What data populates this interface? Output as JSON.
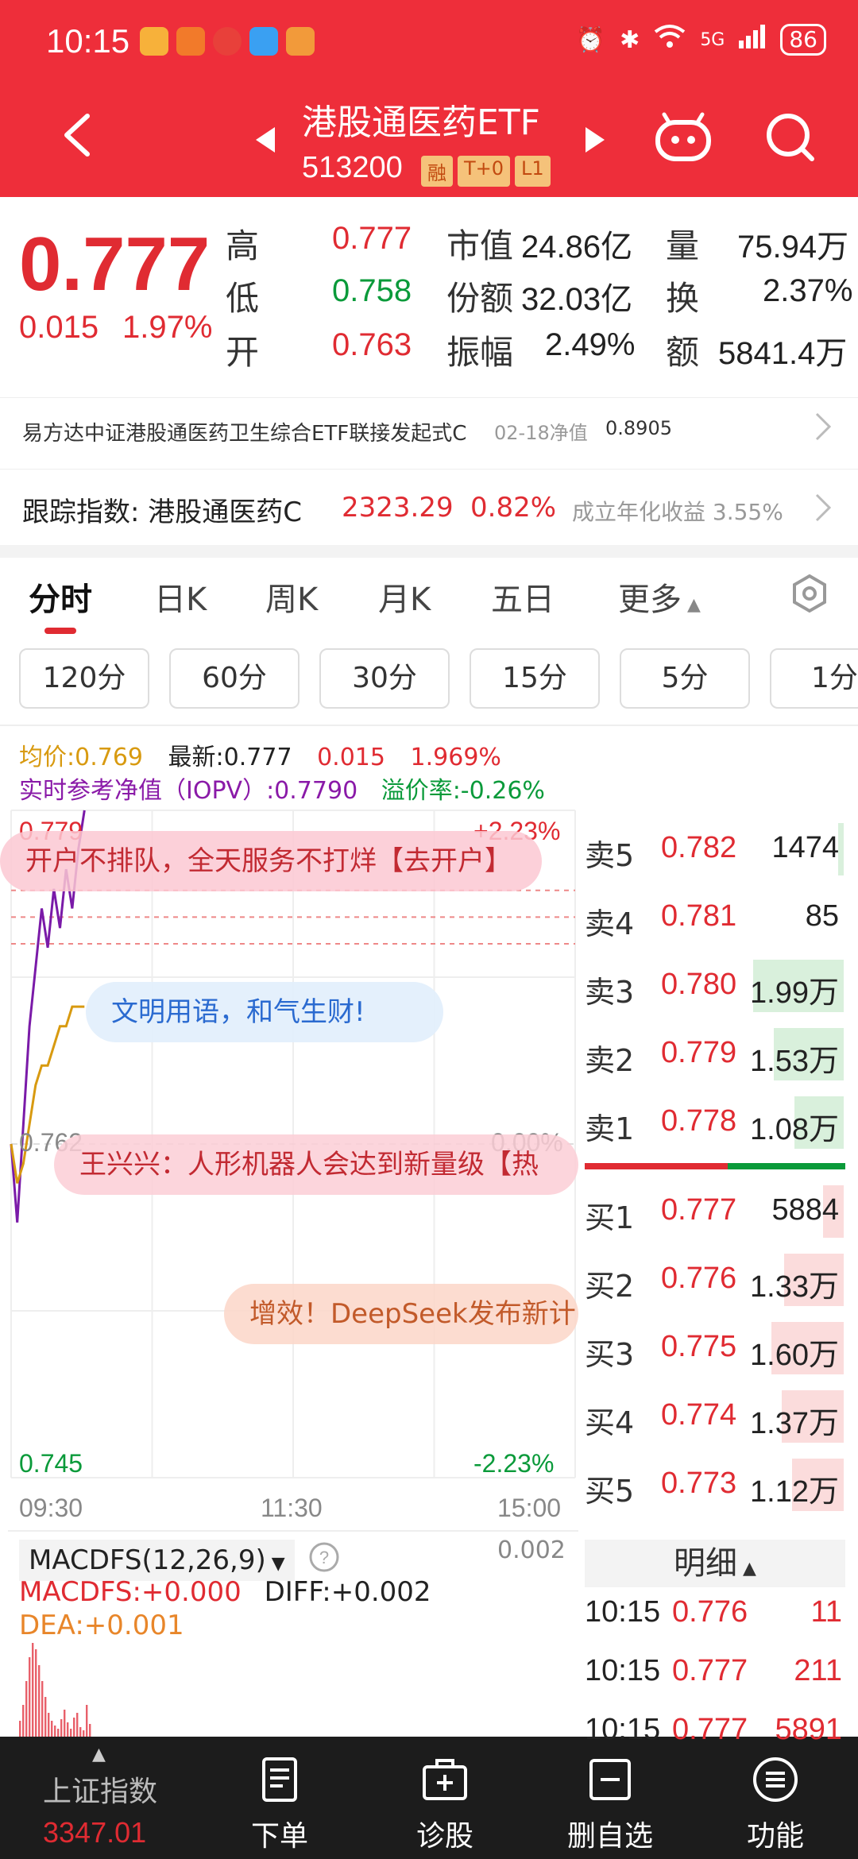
{
  "status_bar": {
    "time": "10:15",
    "battery": "86",
    "network": "5G"
  },
  "header": {
    "name": "港股通医药ETF",
    "code": "513200",
    "tags": [
      "融",
      "T+0",
      "L1"
    ]
  },
  "quote": {
    "price": "0.777",
    "change": "0.015",
    "change_pct": "1.97%",
    "high_label": "高",
    "high": "0.777",
    "low_label": "低",
    "low": "0.758",
    "open_label": "开",
    "open": "0.763",
    "mktcap_label": "市值",
    "mktcap": "24.86亿",
    "shares_label": "份额",
    "shares": "32.03亿",
    "amp_label": "振幅",
    "amp": "2.49%",
    "vol_label": "量",
    "vol": "75.94万",
    "turnover_label": "换",
    "turnover": "2.37%",
    "amount_label": "额",
    "amount": "5841.4万"
  },
  "fund_link": {
    "name": "易方达中证港股通医药卫生综合ETF联接发起式C",
    "date": "02-18净值",
    "nav": "0.8905"
  },
  "index_row": {
    "label": "跟踪指数: 港股通医药C",
    "value": "2323.29",
    "pct": "0.82%",
    "annual": "成立年化收益 3.55%"
  },
  "tabs": [
    "分时",
    "日K",
    "周K",
    "月K",
    "五日",
    "更多"
  ],
  "periods": [
    "120分",
    "60分",
    "30分",
    "15分",
    "5分",
    "1分"
  ],
  "chart_info": {
    "avg": "均价:0.769",
    "latest": "最新:0.777",
    "chg": "0.015",
    "pct": "1.969%",
    "iopv": "实时参考净值（IOPV）:0.7790",
    "premium": "溢价率:-0.26%"
  },
  "chart_labels": {
    "top_price": "0.779",
    "top_pct": "+2.23%",
    "mid_price": "0.762",
    "mid_pct": "0.00%",
    "bot_price": "0.745",
    "bot_pct": "-2.23%",
    "t_start": "09:30",
    "t_mid": "11:30",
    "t_end": "15:00"
  },
  "banners": {
    "b1": "开户不排队，全天服务不打烊【去开户】",
    "b2": "文明用语，和气生财!",
    "b3": "王兴兴：人形机器人会达到新量级【热",
    "b4": "增效！DeepSeek发布新计"
  },
  "chart_data": {
    "type": "line",
    "ylim": [
      0.745,
      0.779
    ],
    "xlim_minutes": [
      0,
      240
    ],
    "series": [
      {
        "values_price": [
          0.762,
          0.758,
          0.763,
          0.768,
          0.771,
          0.774,
          0.772,
          0.775,
          0.773,
          0.776,
          0.774,
          0.777,
          0.779
        ]
      },
      {
        "values_price": [
          0.762,
          0.76,
          0.761,
          0.763,
          0.765,
          0.766,
          0.766,
          0.767,
          0.768,
          0.768,
          0.769,
          0.769,
          0.769
        ]
      }
    ]
  },
  "order_book": {
    "sell": [
      {
        "label": "卖5",
        "price": "0.782",
        "vol": "1474",
        "bar": 0.02
      },
      {
        "label": "卖4",
        "price": "0.781",
        "vol": "85",
        "bar": 0.0
      },
      {
        "label": "卖3",
        "price": "0.780",
        "vol": "1.99万",
        "bar": 0.35
      },
      {
        "label": "卖2",
        "price": "0.779",
        "vol": "1.53万",
        "bar": 0.27
      },
      {
        "label": "卖1",
        "price": "0.778",
        "vol": "1.08万",
        "bar": 0.19
      }
    ],
    "buy": [
      {
        "label": "买1",
        "price": "0.777",
        "vol": "5884",
        "bar": 0.08
      },
      {
        "label": "买2",
        "price": "0.776",
        "vol": "1.33万",
        "bar": 0.23
      },
      {
        "label": "买3",
        "price": "0.775",
        "vol": "1.60万",
        "bar": 0.28
      },
      {
        "label": "买4",
        "price": "0.774",
        "vol": "1.37万",
        "bar": 0.24
      },
      {
        "label": "买5",
        "price": "0.773",
        "vol": "1.12万",
        "bar": 0.2
      }
    ],
    "detail_label": "明细",
    "trades": [
      {
        "time": "10:15",
        "price": "0.776",
        "vol": "11"
      },
      {
        "time": "10:15",
        "price": "0.777",
        "vol": "211"
      },
      {
        "time": "10:15",
        "price": "0.777",
        "vol": "5891"
      }
    ]
  },
  "macd": {
    "selector": "MACDFS(12,26,9)",
    "top_value": "0.002",
    "macdfs": "MACDFS:+0.000",
    "diff": "DIFF:+0.002",
    "dea": "DEA:+0.001"
  },
  "bottom_nav": {
    "index_name": "上证指数",
    "index_value": "3347.01",
    "items": [
      "下单",
      "诊股",
      "删自选",
      "功能"
    ]
  },
  "colors": {
    "brand_red": "#ee2e3a",
    "up": "#e02b32",
    "down": "#0a9a3a"
  }
}
